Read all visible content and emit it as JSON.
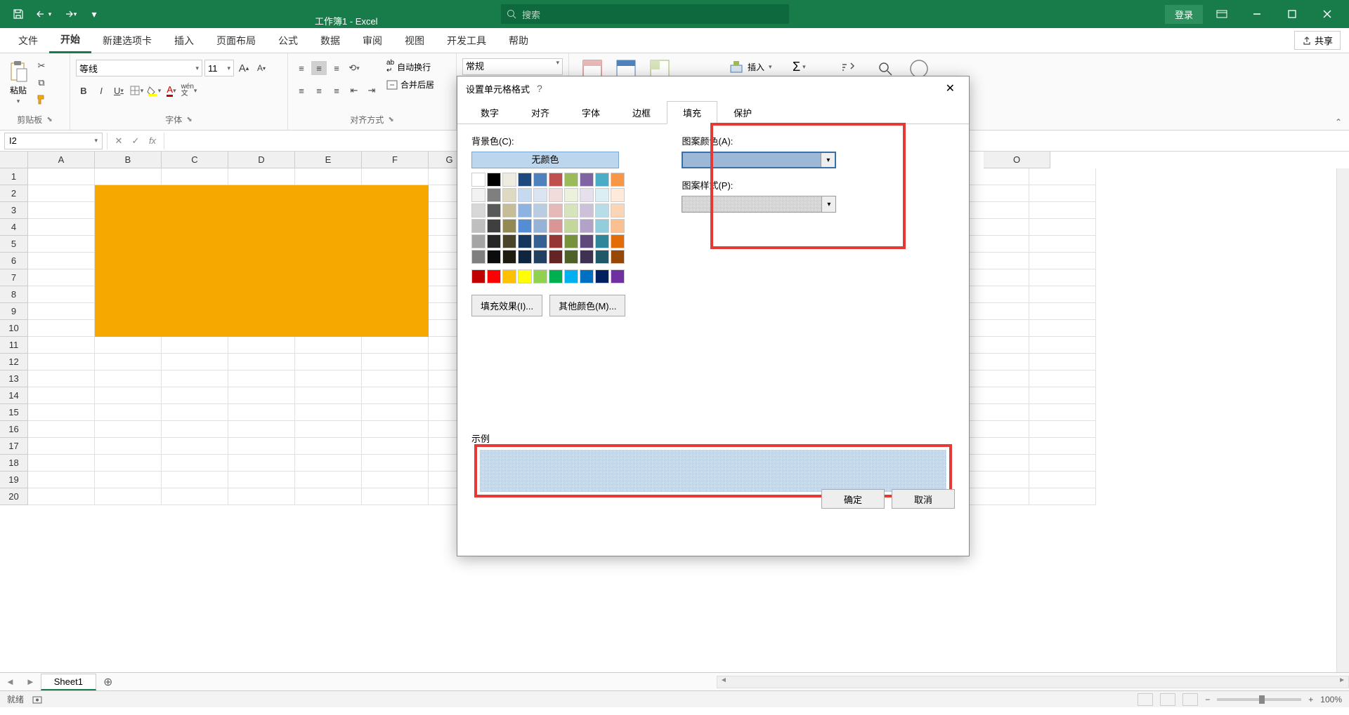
{
  "titlebar": {
    "doc_title": "工作簿1 - Excel",
    "search_placeholder": "搜索",
    "login": "登录"
  },
  "ribbon_tabs": [
    "文件",
    "开始",
    "新建选项卡",
    "插入",
    "页面布局",
    "公式",
    "数据",
    "审阅",
    "视图",
    "开发工具",
    "帮助"
  ],
  "active_tab": "开始",
  "share": "共享",
  "ribbon": {
    "clipboard": {
      "paste": "粘贴",
      "label": "剪贴板"
    },
    "font": {
      "name": "等线",
      "size": "11",
      "label": "字体"
    },
    "align": {
      "wrap": "自动换行",
      "merge": "合并后居",
      "label": "对齐方式"
    },
    "number": {
      "format": "常规"
    },
    "cells": {
      "insert": "插入"
    },
    "edit": {
      "sortfilter": "排序和筛选",
      "findselect": "查找和选择"
    }
  },
  "name_box": "I2",
  "sheet_tab": "Sheet1",
  "status": {
    "ready": "就绪",
    "zoom": "100%"
  },
  "columns": [
    "A",
    "B",
    "C",
    "D",
    "E",
    "F",
    "G",
    "O"
  ],
  "rows": [
    1,
    2,
    3,
    4,
    5,
    6,
    7,
    8,
    9,
    10,
    11,
    12,
    13,
    14,
    15,
    16,
    17,
    18,
    19,
    20
  ],
  "dialog": {
    "title": "设置单元格格式",
    "tabs": [
      "数字",
      "对齐",
      "字体",
      "边框",
      "填充",
      "保护"
    ],
    "active_tab": "填充",
    "bg_label": "背景色(C):",
    "no_color": "无颜色",
    "fill_effects": "填充效果(I)...",
    "more_colors": "其他颜色(M)...",
    "pattern_color": "图案颜色(A):",
    "pattern_style": "图案样式(P):",
    "sample": "示例",
    "ok": "确定",
    "cancel": "取消"
  },
  "palette_row1": [
    "#ffffff",
    "#000000",
    "#eeece1",
    "#1f497d",
    "#4f81bd",
    "#c0504d",
    "#9bbb59",
    "#8064a2",
    "#4bacc6",
    "#f79646"
  ],
  "palette_shades": [
    [
      "#f2f2f2",
      "#7f7f7f",
      "#ddd9c3",
      "#c6d9f0",
      "#dbe5f1",
      "#f2dcdb",
      "#ebf1dd",
      "#e5e0ec",
      "#dbeef3",
      "#fdeada"
    ],
    [
      "#d8d8d8",
      "#595959",
      "#c4bd97",
      "#8db3e2",
      "#b8cce4",
      "#e5b9b7",
      "#d7e3bc",
      "#ccc1d9",
      "#b7dde8",
      "#fbd5b5"
    ],
    [
      "#bfbfbf",
      "#3f3f3f",
      "#938953",
      "#548dd4",
      "#95b3d7",
      "#d99694",
      "#c3d69b",
      "#b2a2c7",
      "#92cddc",
      "#fac08f"
    ],
    [
      "#a5a5a5",
      "#262626",
      "#494429",
      "#17365d",
      "#366092",
      "#953734",
      "#76923c",
      "#5f497a",
      "#31859b",
      "#e36c09"
    ],
    [
      "#7f7f7f",
      "#0c0c0c",
      "#1d1b10",
      "#0f243e",
      "#244061",
      "#632423",
      "#4f6128",
      "#3f3151",
      "#205867",
      "#974806"
    ]
  ],
  "palette_std": [
    "#c00000",
    "#ff0000",
    "#ffc000",
    "#ffff00",
    "#92d050",
    "#00b050",
    "#00b0f0",
    "#0070c0",
    "#002060",
    "#7030a0"
  ]
}
